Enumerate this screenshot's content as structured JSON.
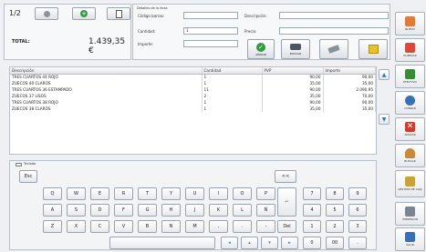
{
  "top": {
    "counter": "1/2",
    "total_label": "TOTAL:",
    "total_value": "1.439,35 €"
  },
  "detail": {
    "heading": "Detalles de la línea",
    "barcode_label": "Código barras:",
    "barcode_value": "",
    "qty_label": "Cantidad:",
    "qty_value": "1",
    "amount_label": "Importe:",
    "amount_value": "",
    "desc_label": "Descripción:",
    "desc_value": "",
    "price_label": "Precio:",
    "price_value": "",
    "add_label": "AÑADIR",
    "search_label": "BUSCAR"
  },
  "table": {
    "headers": [
      "Descripción",
      "Cantidad",
      "PVP",
      "Importe"
    ],
    "rows": [
      [
        "TRES CUARTOS 44 ROJO",
        "1",
        "90,00",
        "90,00"
      ],
      [
        "ZUECOS 40 CLAROS",
        "1",
        "35,00",
        "35,00"
      ],
      [
        "TRES CUARTOS 36 ESTAMPADO",
        "11",
        "90,00",
        "2.090,95"
      ],
      [
        "ZUECOS 37 LISOS",
        "2",
        "35,00",
        "70,00"
      ],
      [
        "TRES CUARTOS 38 ROJO",
        "1",
        "90,00",
        "90,00"
      ],
      [
        "ZUECOS 38 CLAROS",
        "1",
        "35,00",
        "35,00"
      ]
    ]
  },
  "keyboard": {
    "title": "Teclado",
    "esc": "Esc",
    "backspace": "<<",
    "row1": [
      "Q",
      "W",
      "E",
      "R",
      "T",
      "Y",
      "U",
      "I",
      "O",
      "P"
    ],
    "row2": [
      "A",
      "S",
      "D",
      "F",
      "G",
      "H",
      "J",
      "K",
      "L",
      "Ñ"
    ],
    "row3": [
      "Z",
      "X",
      "C",
      "V",
      "B",
      "N",
      "M",
      ",",
      ".",
      "-",
      "Del"
    ],
    "numpad": [
      "7",
      "8",
      "9",
      "4",
      "5",
      "6",
      "1",
      "2",
      "3",
      "0",
      "00",
      "."
    ]
  },
  "sidebar": [
    {
      "label": "NUEVO",
      "icon": "new-document-icon",
      "color": "#e07a3a"
    },
    {
      "label": "ELIMINAR",
      "icon": "delete-line-icon",
      "color": "#d94a3a"
    },
    {
      "label": "EFECTIVO",
      "icon": "cash-icon",
      "color": "#3a8a3a"
    },
    {
      "label": "COBRAR",
      "icon": "people-icon",
      "color": "#3a6fb5"
    },
    {
      "label": "ANULAR",
      "icon": "cancel-icon",
      "color": "#d23a2a"
    },
    {
      "label": "BUSCAR",
      "icon": "person-search-icon",
      "color": "#c8893a"
    },
    {
      "label": "GESTIÓN DE CAJA",
      "icon": "cash-register-icon",
      "color": "#c9a33a"
    },
    {
      "label": "IMPRESIÓN",
      "icon": "printer-icon",
      "color": "#7a8591"
    },
    {
      "label": "SALIR",
      "icon": "exit-icon",
      "color": "#3a6fb5"
    }
  ]
}
